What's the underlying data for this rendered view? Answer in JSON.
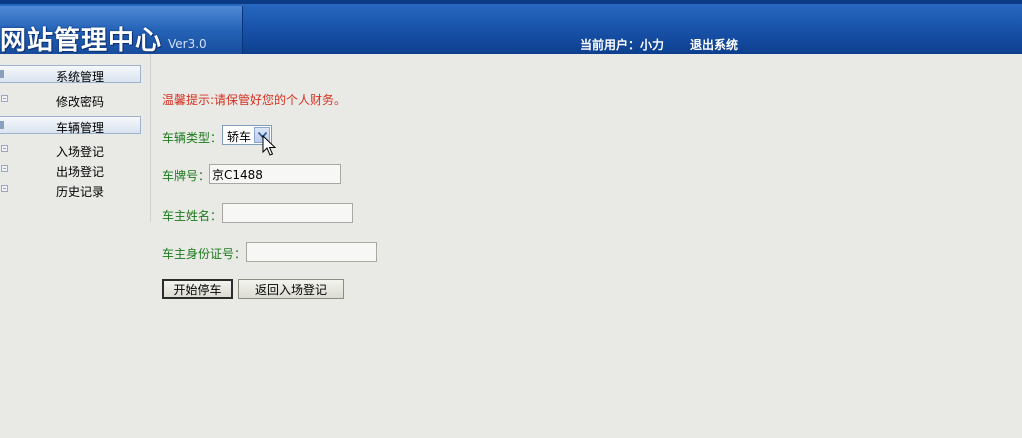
{
  "header": {
    "title": "网站管理中心",
    "version": "Ver3.0",
    "current_user": "当前用户：小力",
    "logout": "退出系统"
  },
  "sidebar": {
    "groups": [
      {
        "label": "系统管理",
        "items": [
          "修改密码"
        ]
      },
      {
        "label": "车辆管理",
        "items": [
          "入场登记",
          "出场登记",
          "历史记录"
        ]
      }
    ]
  },
  "form": {
    "tip": "温馨提示:请保管好您的个人财务。",
    "vehicle_type_label": "车辆类型：",
    "vehicle_type_value": "轿车",
    "plate_label": "车牌号：",
    "plate_value": "京C1488",
    "owner_name_label": "车主姓名：",
    "owner_name_value": "",
    "owner_id_label": "车主身份证号：",
    "owner_id_value": "",
    "start_button": "开始停车",
    "back_button": "返回入场登记"
  },
  "colors": {
    "header_blue": "#1a56ad",
    "label_green": "#1c7a1c",
    "tip_red": "#d6301e",
    "background": "#e9e9e6"
  }
}
